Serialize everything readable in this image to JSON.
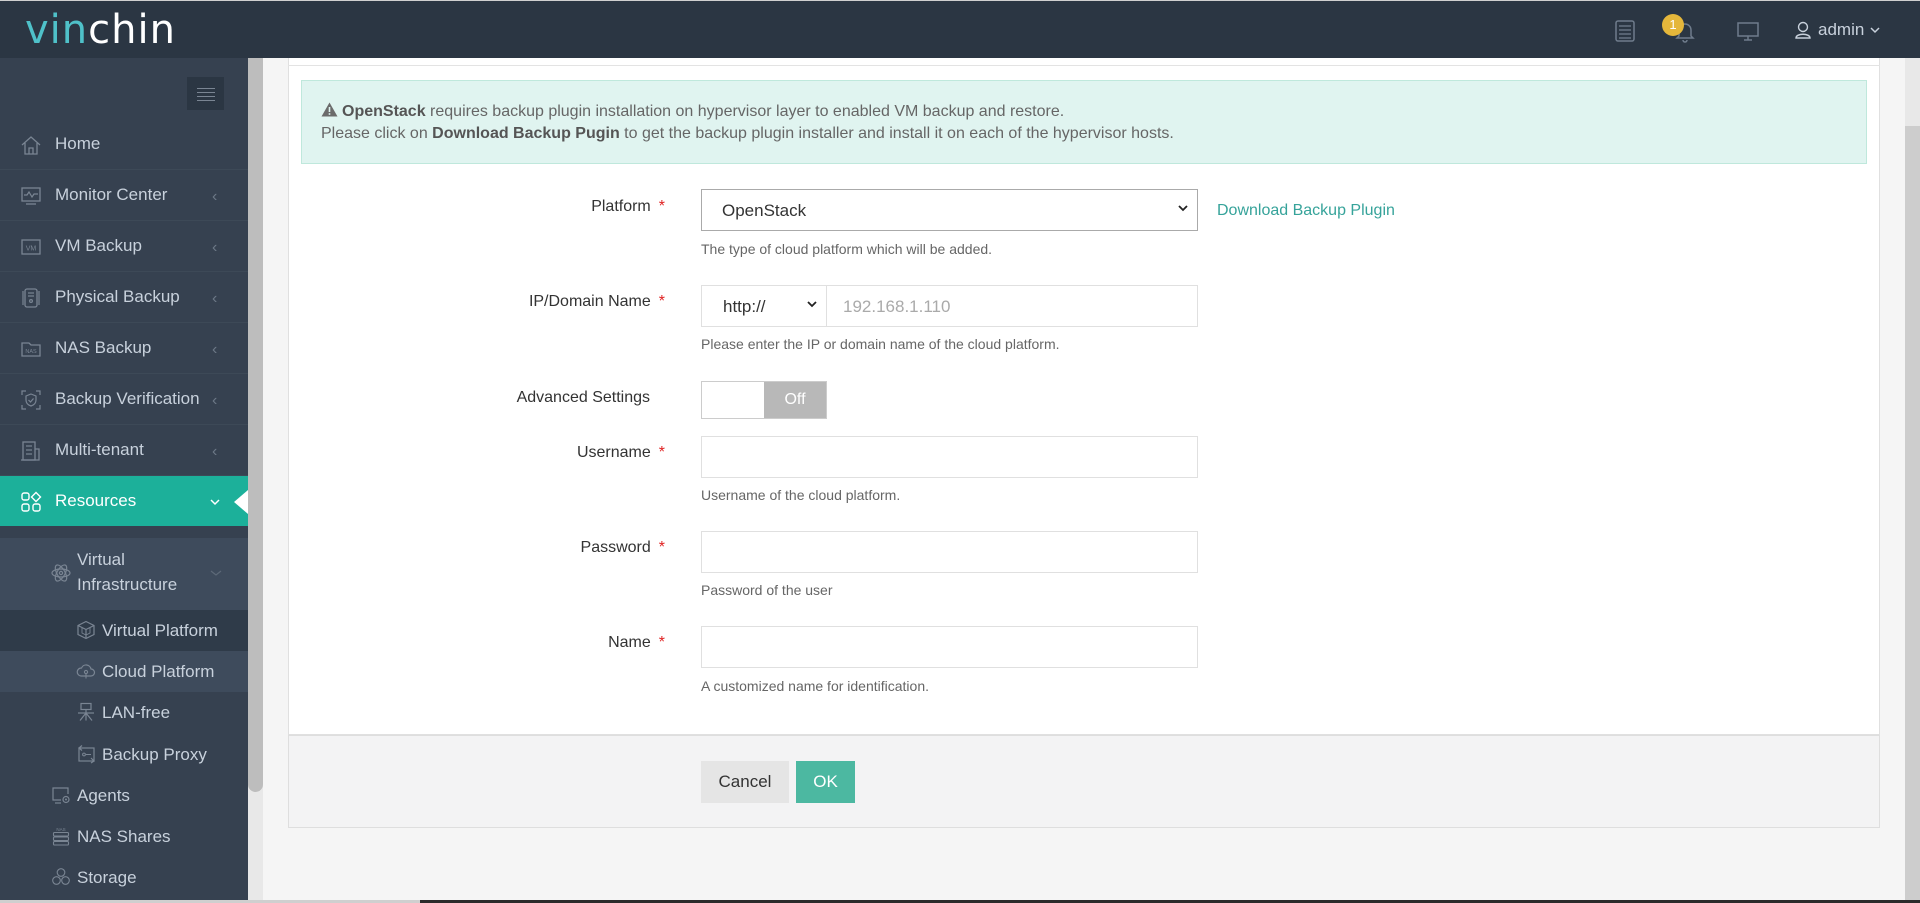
{
  "app": {
    "logo_part1": "vin",
    "logo_part2": "chin",
    "brand_color": "#4fc1c9",
    "accent_color": "#1cb09a"
  },
  "header": {
    "notification_count": "1",
    "user_name": "admin",
    "icons": [
      "task-list-icon",
      "bell-icon",
      "monitor-icon",
      "user-icon",
      "chevron-down-icon"
    ]
  },
  "sidebar": {
    "items": [
      {
        "label": "Home",
        "icon": "home-icon"
      },
      {
        "label": "Monitor Center",
        "icon": "monitor-center-icon"
      },
      {
        "label": "VM Backup",
        "icon": "vm-icon"
      },
      {
        "label": "Physical Backup",
        "icon": "physical-server-icon"
      },
      {
        "label": "NAS Backup",
        "icon": "nas-icon"
      },
      {
        "label": "Backup Verification",
        "icon": "shield-check-icon"
      },
      {
        "label": "Multi-tenant",
        "icon": "building-icon"
      },
      {
        "label": "Resources",
        "icon": "grid-icon",
        "active": true
      }
    ],
    "resources_children": {
      "group": {
        "label_line1": "Virtual",
        "label_line2": "Infrastructure",
        "icon": "atom-icon"
      },
      "group_items": [
        {
          "label": "Virtual Platform",
          "icon": "cube-icon"
        },
        {
          "label": "Cloud Platform",
          "icon": "cloud-icon",
          "selected": true
        },
        {
          "label": "LAN-free",
          "icon": "lan-icon"
        },
        {
          "label": "Backup Proxy",
          "icon": "proxy-icon"
        }
      ],
      "items": [
        {
          "label": "Agents",
          "icon": "agent-icon"
        },
        {
          "label": "NAS Shares",
          "icon": "nas-shares-icon"
        },
        {
          "label": "Storage",
          "icon": "storage-icon"
        }
      ]
    }
  },
  "alert": {
    "line1_bold": "OpenStack",
    "line1_rest": " requires backup plugin installation on hypervisor layer to enabled VM backup and restore.",
    "line2_pre": "Please click on ",
    "line2_bold": "Download Backup Pugin",
    "line2_post": " to get the backup plugin installer and install it on each of the hypervisor hosts."
  },
  "form": {
    "required_mark": "*",
    "platform": {
      "label": "Platform",
      "value": "OpenStack",
      "help": "The type of cloud platform which will be added.",
      "link": "Download Backup Plugin"
    },
    "ip": {
      "label": "IP/Domain Name",
      "protocol": "http://",
      "placeholder": "192.168.1.110",
      "help": "Please enter the IP or domain name of the cloud platform."
    },
    "advanced": {
      "label": "Advanced Settings",
      "state": "Off"
    },
    "username": {
      "label": "Username",
      "value": "",
      "help": "Username of the cloud platform."
    },
    "password": {
      "label": "Password",
      "value": "",
      "help": "Password of the user"
    },
    "name": {
      "label": "Name",
      "value": "",
      "help": "A customized name for identification."
    }
  },
  "actions": {
    "cancel": "Cancel",
    "ok": "OK"
  }
}
